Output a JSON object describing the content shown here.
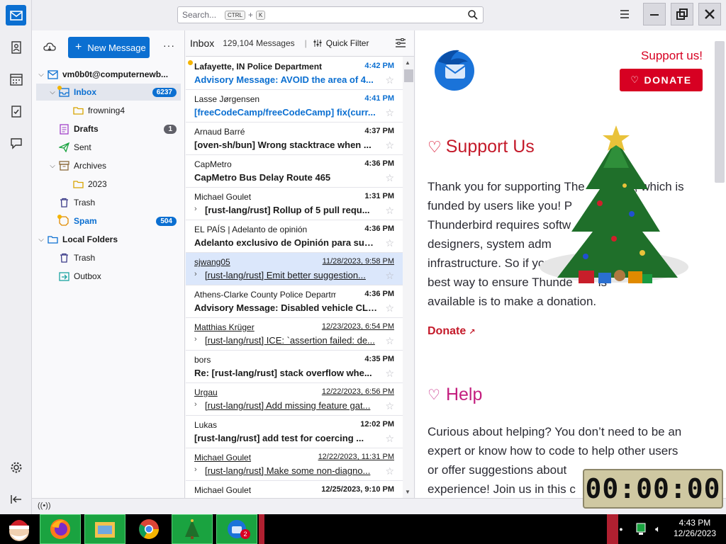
{
  "search": {
    "placeholder": "Search...",
    "kbd1": "CTRL",
    "plus": "+",
    "kbd2": "K"
  },
  "folders": {
    "new_message": "New Message",
    "account": "vm0b0t@computernewb...",
    "items": [
      {
        "label": "Inbox",
        "count": "6237"
      },
      {
        "label": "frowning4"
      },
      {
        "label": "Drafts",
        "count": "1"
      },
      {
        "label": "Sent"
      },
      {
        "label": "Archives"
      },
      {
        "label": "2023"
      },
      {
        "label": "Trash"
      },
      {
        "label": "Spam",
        "count": "504"
      },
      {
        "label": "Local Folders"
      },
      {
        "label": "Trash"
      },
      {
        "label": "Outbox"
      }
    ]
  },
  "list": {
    "folder": "Inbox",
    "count": "129,104 Messages",
    "quick_filter": "Quick Filter",
    "messages": [
      {
        "from": "Lafayette, IN Police Department",
        "time": "4:42 PM",
        "subject": "Advisory Message: AVOID the area of 4..."
      },
      {
        "from": "Lasse Jørgensen",
        "time": "4:41 PM",
        "subject": "[freeCodeCamp/freeCodeCamp] fix(curr..."
      },
      {
        "from": "Arnaud Barré",
        "time": "4:37 PM",
        "subject": "[oven-sh/bun] Wrong stacktrace when ..."
      },
      {
        "from": "CapMetro",
        "time": "4:36 PM",
        "subject": "CapMetro Bus Delay Route 465"
      },
      {
        "from": "Michael Goulet",
        "time": "1:31 PM",
        "subject": "[rust-lang/rust] Rollup of 5 pull requ..."
      },
      {
        "from": "EL PAÍS | Adelanto de opinión",
        "time": "4:36 PM",
        "subject": "Adelanto exclusivo de Opinión para sub..."
      },
      {
        "from": "sjwang05",
        "time": "11/28/2023, 9:58 PM",
        "subject": "[rust-lang/rust] Emit better suggestion..."
      },
      {
        "from": "Athens-Clarke County Police Department",
        "time": "4:36 PM",
        "subject": "Advisory Message: Disabled vehicle CLE..."
      },
      {
        "from": "Matthias Krüger",
        "time": "12/23/2023, 6:54 PM",
        "subject": "[rust-lang/rust] ICE: `assertion failed: de..."
      },
      {
        "from": "bors",
        "time": "4:35 PM",
        "subject": "Re: [rust-lang/rust] stack overflow whe..."
      },
      {
        "from": "Urgau",
        "time": "12/22/2023, 6:56 PM",
        "subject": "[rust-lang/rust] Add missing feature gat..."
      },
      {
        "from": "Lukas",
        "time": "12:02 PM",
        "subject": "[rust-lang/rust] add test for coercing ..."
      },
      {
        "from": "Michael Goulet",
        "time": "12/22/2023, 11:31 PM",
        "subject": "[rust-lang/rust] Make some non-diagno..."
      },
      {
        "from": "Michael Goulet",
        "time": "12/25/2023, 9:10 PM",
        "subject": ""
      }
    ]
  },
  "reader": {
    "support_link": "Support us!",
    "donate_button": "DONATE",
    "support_heading": "Support Us",
    "support_text_lines": [
      "Thank you for supporting The",
      ", which is",
      "funded by users like you! P",
      "Thunderbird requires softw",
      "designers, system adm",
      "infrastructure. So if you",
      "the",
      "best way to ensure Thunde",
      "is",
      "available is to make a donation."
    ],
    "donate_link": "Donate",
    "help_heading": "Help",
    "help_text_lines": [
      "Curious about helping? You don’t need to be an",
      "expert or know how to code to help other users",
      "or offer suggestions about",
      "experience! Join us in this c"
    ]
  },
  "timer": "00:00:00",
  "clock": {
    "time": "4:43 PM",
    "date": "12/26/2023"
  },
  "taskbar": {
    "thunderbird_badge": "2"
  },
  "colors": {
    "accent": "#0b6fd1",
    "donate_red": "#d70022",
    "help_pink": "#c41f7f",
    "selected_row": "#dbe7fb"
  }
}
